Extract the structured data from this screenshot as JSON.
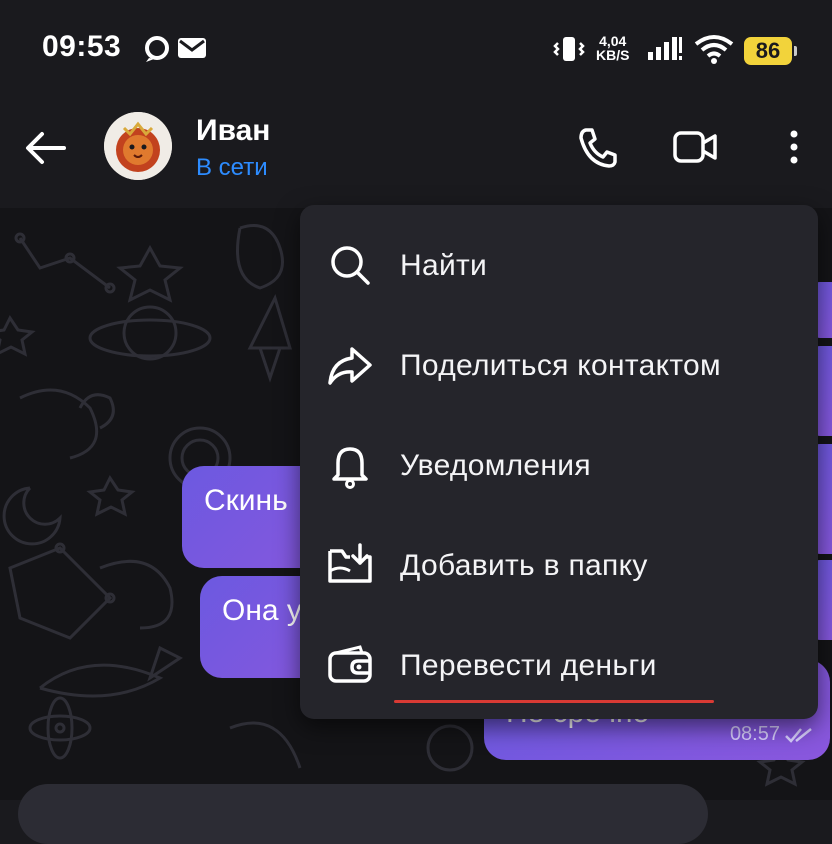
{
  "status_bar": {
    "time": "09:53",
    "net_speed_value": "4,04",
    "net_speed_unit": "KB/S",
    "battery": "86"
  },
  "header": {
    "contact_name": "Иван",
    "contact_status": "В сети"
  },
  "messages": [
    {
      "text": "Скинь"
    },
    {
      "text": "Она у"
    },
    {
      "text": "Не срочно",
      "time": "08:57"
    }
  ],
  "menu": {
    "items": [
      {
        "label": "Найти",
        "icon": "search-icon"
      },
      {
        "label": "Поделиться контактом",
        "icon": "share-icon"
      },
      {
        "label": "Уведомления",
        "icon": "bell-icon"
      },
      {
        "label": "Добавить в папку",
        "icon": "folder-add-icon"
      },
      {
        "label": "Перевести деньги",
        "icon": "wallet-icon"
      }
    ]
  },
  "colors": {
    "accent_blue": "#2d8cff",
    "bubble_start": "#6c59e0",
    "bubble_end": "#8a57dd",
    "battery": "#f2d33b",
    "underline": "#d93a34"
  }
}
